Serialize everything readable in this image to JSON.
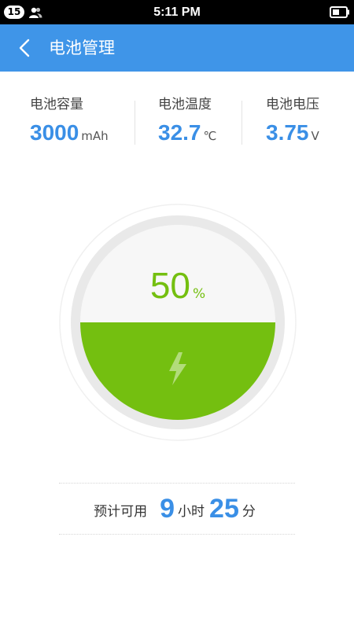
{
  "status_bar": {
    "notification_count": "15",
    "time": "5:11 PM",
    "icons": [
      "contacts-icon",
      "battery-icon"
    ]
  },
  "header": {
    "title": "电池管理",
    "back_icon": "chevron-left-icon",
    "background_color": "#3f95e8"
  },
  "battery_stats": {
    "capacity": {
      "label": "电池容量",
      "value": "3000",
      "unit": "mAh"
    },
    "temperature": {
      "label": "电池温度",
      "value": "32.7",
      "unit": "℃"
    },
    "voltage": {
      "label": "电池电压",
      "value": "3.75",
      "unit": "V"
    }
  },
  "gauge": {
    "percent": "50",
    "percent_sign": "%",
    "level_fraction": 0.5,
    "fill_color": "#74bf10",
    "charging_icon": "lightning-bolt-icon"
  },
  "estimate": {
    "label": "预计可用",
    "hours": "9",
    "hours_unit": "小时",
    "minutes": "25",
    "minutes_unit": "分"
  }
}
